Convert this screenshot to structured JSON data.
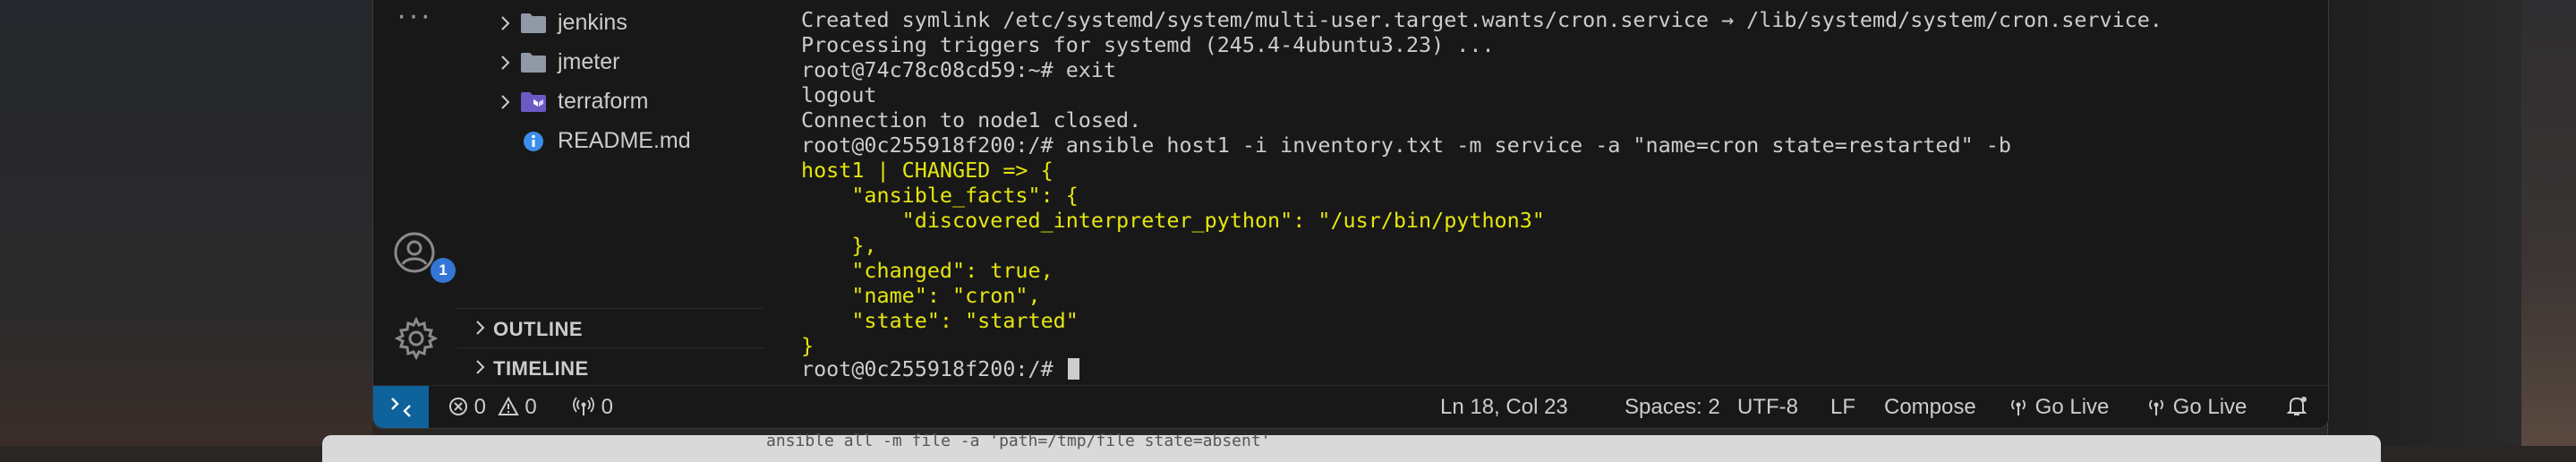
{
  "explorer": {
    "items": [
      {
        "label": "jenkins",
        "icon": "folder-icon",
        "expandable": true
      },
      {
        "label": "jmeter",
        "icon": "folder-icon",
        "expandable": true
      },
      {
        "label": "terraform",
        "icon": "terraform-folder-icon",
        "expandable": true
      },
      {
        "label": "README.md",
        "icon": "info-icon",
        "expandable": false
      }
    ],
    "sections": [
      {
        "label": "OUTLINE"
      },
      {
        "label": "TIMELINE"
      }
    ]
  },
  "activity_bar": {
    "more": "···",
    "accounts_badge": "1"
  },
  "terminal": {
    "colors": {
      "text": "#cccccc",
      "highlight": "#e5e510"
    },
    "lines": [
      {
        "text": "Created symlink /etc/systemd/system/multi-user.target.wants/cron.service → /lib/systemd/system/cron.service.",
        "style": "normal"
      },
      {
        "text": "Processing triggers for systemd (245.4-4ubuntu3.23) ...",
        "style": "normal"
      },
      {
        "text": "root@74c78c08cd59:~# exit",
        "style": "normal"
      },
      {
        "text": "logout",
        "style": "normal"
      },
      {
        "text": "Connection to node1 closed.",
        "style": "normal"
      },
      {
        "text": "root@0c255918f200:/# ansible host1 -i inventory.txt -m service -a \"name=cron state=restarted\" -b",
        "style": "normal"
      },
      {
        "text": "host1 | CHANGED => {",
        "style": "yellow"
      },
      {
        "text": "    \"ansible_facts\": {",
        "style": "yellow"
      },
      {
        "text": "        \"discovered_interpreter_python\": \"/usr/bin/python3\"",
        "style": "yellow"
      },
      {
        "text": "    },",
        "style": "yellow"
      },
      {
        "text": "    \"changed\": true,",
        "style": "yellow"
      },
      {
        "text": "    \"name\": \"cron\",",
        "style": "yellow"
      },
      {
        "text": "    \"state\": \"started\"",
        "style": "yellow"
      },
      {
        "text": "}",
        "style": "yellow"
      }
    ],
    "prompt": "root@0c255918f200:/# "
  },
  "statusbar": {
    "errors": "0",
    "warnings": "0",
    "ports": "0",
    "position": "Ln 18, Col 23",
    "spaces": "Spaces: 2",
    "encoding": "UTF-8",
    "eol": "LF",
    "language": "Compose",
    "go_live_1": "Go Live",
    "go_live_2": "Go Live",
    "accent": "#0e639c"
  },
  "background_window": {
    "text": "ansible all -m file -a 'path=/tmp/file state=absent'"
  }
}
